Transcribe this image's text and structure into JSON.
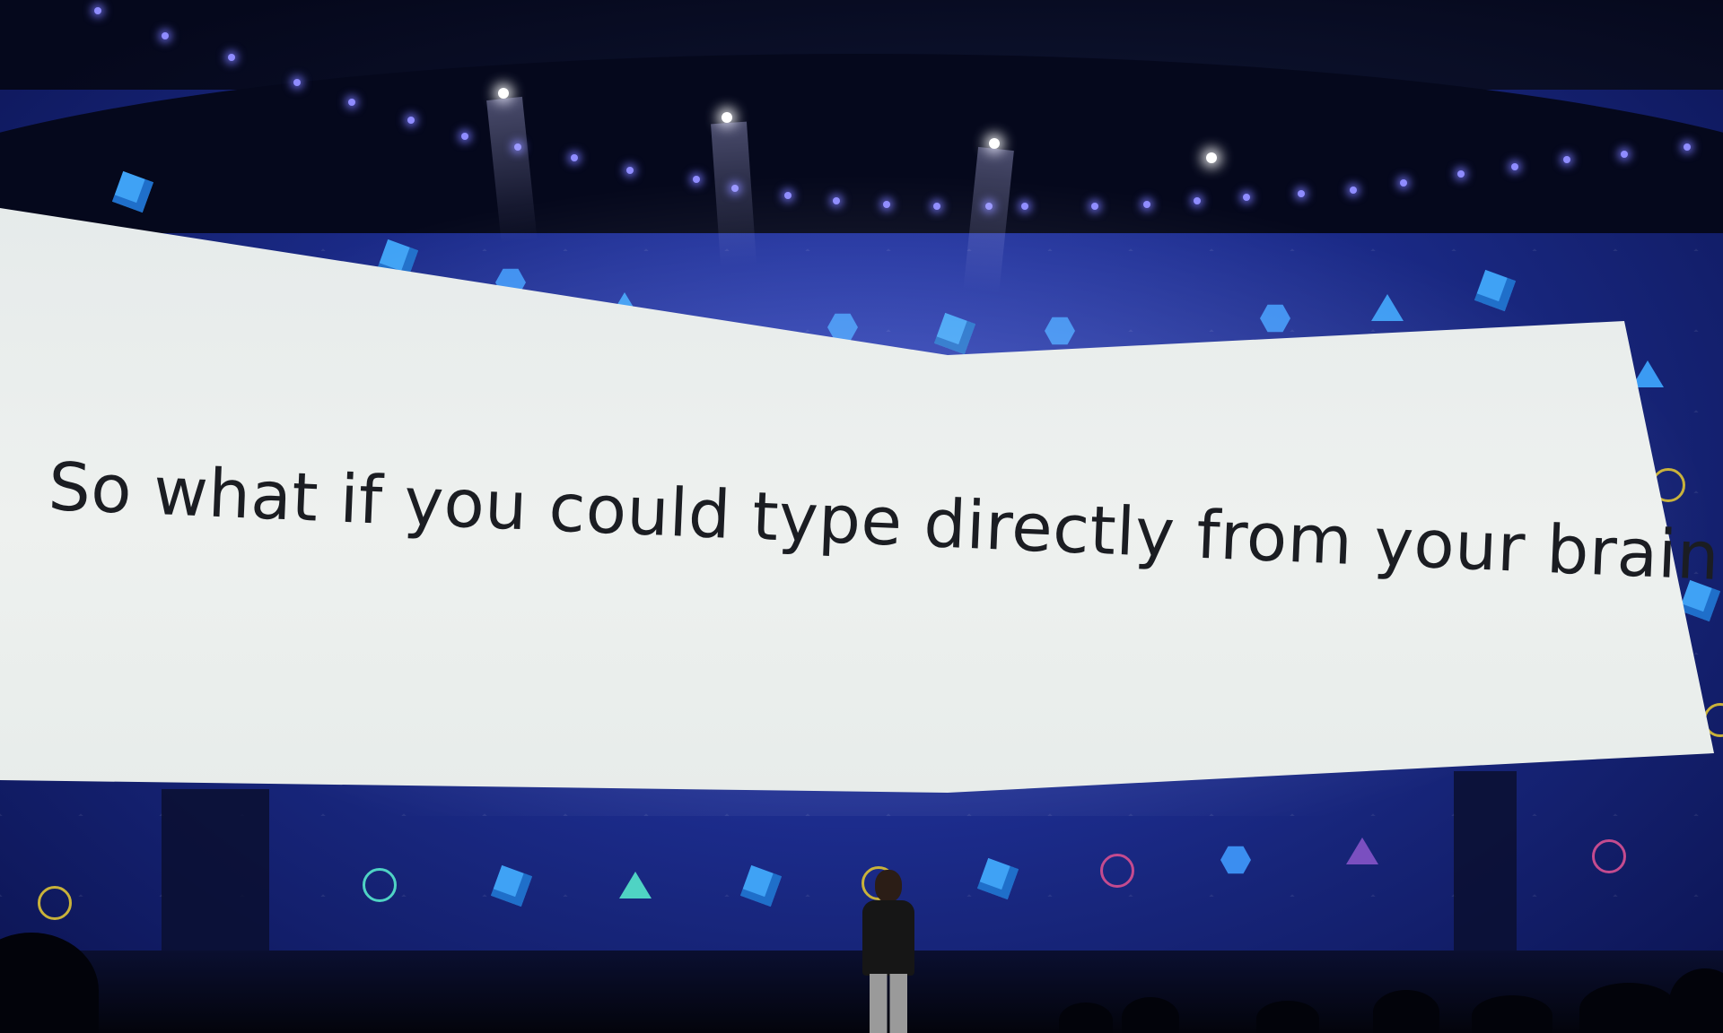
{
  "screen": {
    "caption": "So what if you could type directly from your brain?",
    "cursor_color": "#2a64e0"
  },
  "colors": {
    "backdrop_blue": "#1f2f9a",
    "screen_white": "#eef1ef",
    "text_dark": "#1b1d22",
    "ceiling_dark": "#05081c"
  },
  "decor_icons": [
    "cube-icon",
    "hexagon-icon",
    "pyramid-icon",
    "dodecahedron-outline-icon",
    "octahedron-outline-icon"
  ]
}
